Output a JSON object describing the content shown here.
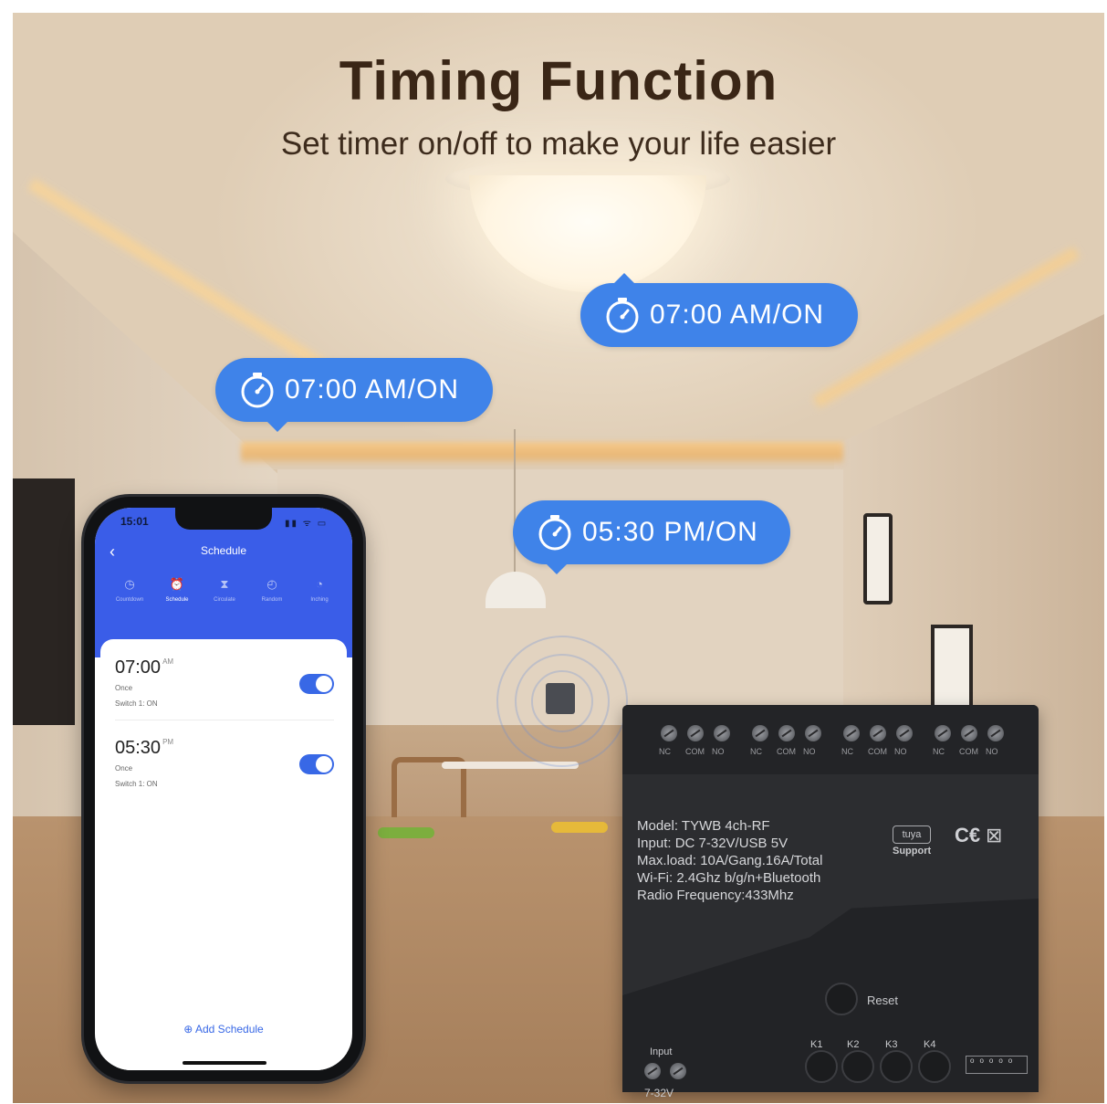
{
  "headline": {
    "title": "Timing Function",
    "subtitle": "Set timer on/off to make your life easier"
  },
  "bubbles": [
    {
      "text": "07:00 AM/ON",
      "icon": "timer-icon"
    },
    {
      "text": "07:00 AM/ON",
      "icon": "timer-icon"
    },
    {
      "text": "05:30 PM/ON",
      "icon": "timer-icon"
    }
  ],
  "phone": {
    "status_time": "15:01",
    "screen_title": "Schedule",
    "tabs": [
      {
        "label": "Countdown",
        "icon": "clock-icon"
      },
      {
        "label": "Schedule",
        "icon": "alarm-icon"
      },
      {
        "label": "Circulate",
        "icon": "hourglass-icon"
      },
      {
        "label": "Random",
        "icon": "stopwatch-icon"
      },
      {
        "label": "Inching",
        "icon": "timer-icon"
      }
    ],
    "active_tab": "Schedule",
    "schedules": [
      {
        "time": "07:00",
        "ampm": "AM",
        "repeat": "Once",
        "action": "Switch 1: ON",
        "enabled": true
      },
      {
        "time": "05:30",
        "ampm": "PM",
        "repeat": "Once",
        "action": "Switch 1: ON",
        "enabled": true
      }
    ],
    "add_label": "Add Schedule"
  },
  "device": {
    "terminal_groups": [
      [
        "NC",
        "COM",
        "NO"
      ],
      [
        "NC",
        "COM",
        "NO"
      ],
      [
        "NC",
        "COM",
        "NO"
      ],
      [
        "NC",
        "COM",
        "NO"
      ]
    ],
    "specs": [
      "Model:  TYWB 4ch-RF",
      "Input:  DC 7-32V/USB 5V",
      "Max.load:  10A/Gang.16A/Total",
      "Wi-Fi:  2.4Ghz b/g/n+Bluetooth",
      "Radio Frequency:433Mhz"
    ],
    "tuya_logo": "tuya",
    "tuya_support": "Support",
    "ce_mark": "C€",
    "reset_label": "Reset",
    "input_label": "Input",
    "voltage_label": "7-32V",
    "buttons": [
      "K1",
      "K2",
      "K3",
      "K4"
    ],
    "colors": {
      "body": "#2c2d30",
      "bubble": "#3f83e9",
      "app_accent": "#3a5de8"
    }
  }
}
